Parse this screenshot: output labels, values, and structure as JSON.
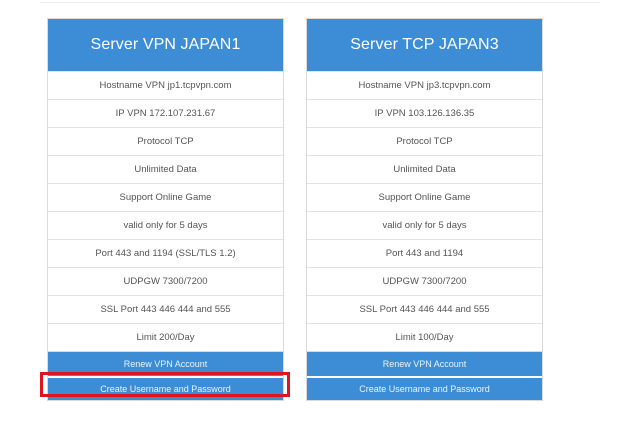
{
  "colors": {
    "header_blue": "#3c8dd6",
    "highlight_red": "#e0141e"
  },
  "servers": [
    {
      "title": "Server VPN JAPAN1",
      "features": [
        "Hostname VPN jp1.tcpvpn.com",
        "IP VPN 172.107.231.67",
        "Protocol TCP",
        "Unlimited Data",
        "Support Online Game",
        "valid only for 5 days",
        "Port 443 and 1194 (SSL/TLS 1.2)",
        "UDPGW 7300/7200",
        "SSL Port 443 446 444 and 555",
        "Limit 200/Day"
      ],
      "renew_label": "Renew VPN Account",
      "create_label": "Create Username and Password"
    },
    {
      "title": "Server TCP JAPAN3",
      "features": [
        "Hostname VPN jp3.tcpvpn.com",
        "IP VPN 103.126.136.35",
        "Protocol TCP",
        "Unlimited Data",
        "Support Online Game",
        "valid only for 5 days",
        "Port 443 and 1194",
        "UDPGW 7300/7200",
        "SSL Port 443 446 444 and 555",
        "Limit 100/Day"
      ],
      "renew_label": "Renew VPN Account",
      "create_label": "Create Username and Password"
    }
  ]
}
